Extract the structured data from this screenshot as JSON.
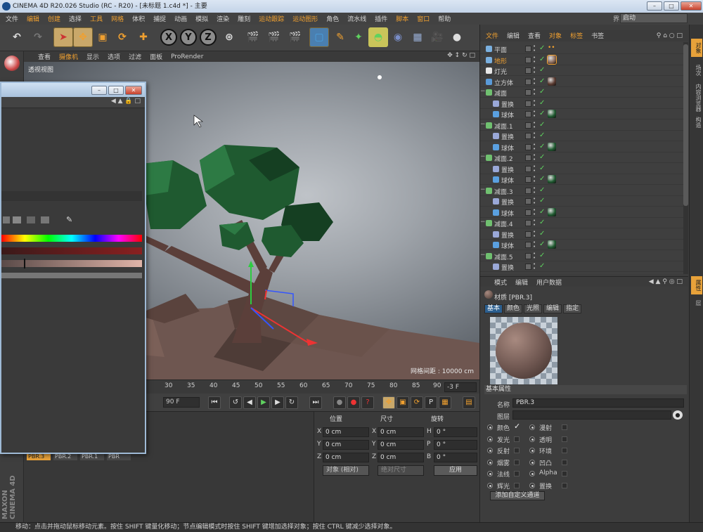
{
  "app": {
    "title": "CINEMA 4D R20.026 Studio (RC - R20) - [未标题 1.c4d *] - 主要",
    "layout_label": "界面",
    "layout_value": "启动"
  },
  "menu": [
    "文件",
    "编辑",
    "创建",
    "选择",
    "工具",
    "网格",
    "体积",
    "捕捉",
    "动画",
    "模拟",
    "渲染",
    "雕刻",
    "运动跟踪",
    "运动图形",
    "角色",
    "流水线",
    "插件",
    "脚本",
    "窗口",
    "帮助"
  ],
  "viewport": {
    "menu": [
      "查看",
      "摄像机",
      "显示",
      "选项",
      "过滤",
      "面板",
      "ProRender"
    ],
    "label": "透视视图",
    "grid_label": "网格间距 : 10000 cm"
  },
  "timeline": {
    "ticks": [
      "30",
      "35",
      "40",
      "45",
      "50",
      "55",
      "60",
      "65",
      "70",
      "75",
      "80",
      "85",
      "90"
    ],
    "frame": "-3 F",
    "end_frame": "90 F"
  },
  "materials": [
    "PBR.3",
    "PBR.2",
    "PBR.1",
    "PBR"
  ],
  "brand": "MAXON CINEMA 4D",
  "coords": {
    "headers": [
      "位置",
      "尺寸",
      "旋转"
    ],
    "rows": [
      {
        "axis": "X",
        "pos": "0 cm",
        "size_axis": "X",
        "size": "0 cm",
        "rot_axis": "H",
        "rot": "0 °"
      },
      {
        "axis": "Y",
        "pos": "0 cm",
        "size_axis": "Y",
        "size": "0 cm",
        "rot_axis": "P",
        "rot": "0 °"
      },
      {
        "axis": "Z",
        "pos": "0 cm",
        "size_axis": "Z",
        "size": "0 cm",
        "rot_axis": "B",
        "rot": "0 °"
      }
    ],
    "mode": "对象 (相对)",
    "size_mode": "绝对尺寸",
    "apply": "应用"
  },
  "object_manager": {
    "menu": [
      "文件",
      "编辑",
      "查看",
      "对象",
      "标签",
      "书签"
    ],
    "objects": [
      {
        "name": "平面",
        "level": 0,
        "icon": "#7ab0e0",
        "tag": "dots"
      },
      {
        "name": "地形",
        "level": 0,
        "icon": "#7ab0e0",
        "tag": "#8a6a5a",
        "selected": true
      },
      {
        "name": "灯光",
        "level": 0,
        "icon": "#e8e8e8",
        "tag": ""
      },
      {
        "name": "立方体",
        "level": 0,
        "icon": "#5a9ad8",
        "tag": "#5a3a30"
      },
      {
        "name": "减面",
        "level": 0,
        "icon": "#70c070",
        "tag": ""
      },
      {
        "name": "置换",
        "level": 1,
        "icon": "#9aa8d8",
        "tag": ""
      },
      {
        "name": "球体",
        "level": 1,
        "icon": "#5aa0e0",
        "tag": "#1f5a30"
      },
      {
        "name": "减面.1",
        "level": 0,
        "icon": "#70c070",
        "tag": ""
      },
      {
        "name": "置换",
        "level": 1,
        "icon": "#9aa8d8",
        "tag": ""
      },
      {
        "name": "球体",
        "level": 1,
        "icon": "#5aa0e0",
        "tag": "#1f5a30"
      },
      {
        "name": "减面.2",
        "level": 0,
        "icon": "#70c070",
        "tag": ""
      },
      {
        "name": "置换",
        "level": 1,
        "icon": "#9aa8d8",
        "tag": ""
      },
      {
        "name": "球体",
        "level": 1,
        "icon": "#5aa0e0",
        "tag": "#1f5a30"
      },
      {
        "name": "减面.3",
        "level": 0,
        "icon": "#70c070",
        "tag": ""
      },
      {
        "name": "置换",
        "level": 1,
        "icon": "#9aa8d8",
        "tag": ""
      },
      {
        "name": "球体",
        "level": 1,
        "icon": "#5aa0e0",
        "tag": "#1f5a30"
      },
      {
        "name": "减面.4",
        "level": 0,
        "icon": "#70c070",
        "tag": ""
      },
      {
        "name": "置换",
        "level": 1,
        "icon": "#9aa8d8",
        "tag": ""
      },
      {
        "name": "球体",
        "level": 1,
        "icon": "#5aa0e0",
        "tag": "#1f5a30"
      },
      {
        "name": "减面.5",
        "level": 0,
        "icon": "#70c070",
        "tag": ""
      },
      {
        "name": "置换",
        "level": 1,
        "icon": "#9aa8d8",
        "tag": ""
      }
    ]
  },
  "attributes": {
    "menu": [
      "模式",
      "编辑",
      "用户数据"
    ],
    "title": "材质 [PBR.3]",
    "tabs": [
      "基本",
      "颜色",
      "光照",
      "编辑",
      "指定"
    ],
    "section": "基本属性",
    "name_label": "名称",
    "name_value": "PBR.3",
    "layer_label": "图层",
    "channels": [
      {
        "left": "颜色",
        "left_checked": true,
        "right": "漫射",
        "right_checked": false
      },
      {
        "left": "发光",
        "left_checked": false,
        "right": "透明",
        "right_checked": false
      },
      {
        "left": "反射",
        "left_checked": false,
        "right": "环境",
        "right_checked": false
      },
      {
        "left": "烟雾",
        "left_checked": false,
        "right": "凹凸",
        "right_checked": false
      },
      {
        "left": "法线",
        "left_checked": false,
        "right": "Alpha",
        "right_checked": false
      },
      {
        "left": "辉光",
        "left_checked": false,
        "right": "置换",
        "right_checked": false
      }
    ],
    "add_channel": "添加自定义通道"
  },
  "side_tabs": [
    "对象",
    "场次",
    "内容浏览器",
    "构造",
    "属性",
    "层"
  ],
  "status": "移动：点击并拖动鼠标移动元素。按住 SHIFT 键量化移动；节点编辑模式时按住 SHIFT 键增加选择对象；按住 CTRL 键减少选择对象。",
  "colors": {
    "accent": "#f0a030",
    "check": "#5fd25f",
    "tree_green": "#1f5a30",
    "terrain": "#6e5650"
  }
}
